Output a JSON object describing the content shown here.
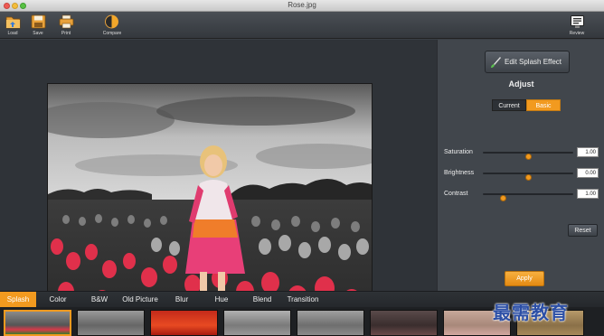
{
  "window": {
    "title": "Rose.jpg"
  },
  "toolbar": {
    "load": "Load",
    "save": "Save",
    "print": "Print",
    "compare": "Compare",
    "review": "Review"
  },
  "panel": {
    "edit_button": "Edit Splash Effect",
    "adjust_title": "Adjust",
    "segment_current": "Current",
    "segment_basic": "Basic",
    "sliders": [
      {
        "label": "Saturation",
        "value": "1.00",
        "level": 0.5
      },
      {
        "label": "Brightness",
        "value": "0.00",
        "level": 0.5
      },
      {
        "label": "Contrast",
        "value": "1.00",
        "level": 0.22
      }
    ],
    "reset": "Reset",
    "apply": "Apply"
  },
  "tabs": [
    "Splash",
    "Color",
    "B&W",
    "Old Picture",
    "Blur",
    "Hue",
    "Blend",
    "Transition"
  ],
  "active_tab": "Splash",
  "thumbnails": [
    "splash",
    "bw",
    "red",
    "gray",
    "bw",
    "dark",
    "pink",
    "sepia"
  ],
  "watermark": "最需教育",
  "colors": {
    "accent": "#f29a1f",
    "panel": "#41464c"
  }
}
